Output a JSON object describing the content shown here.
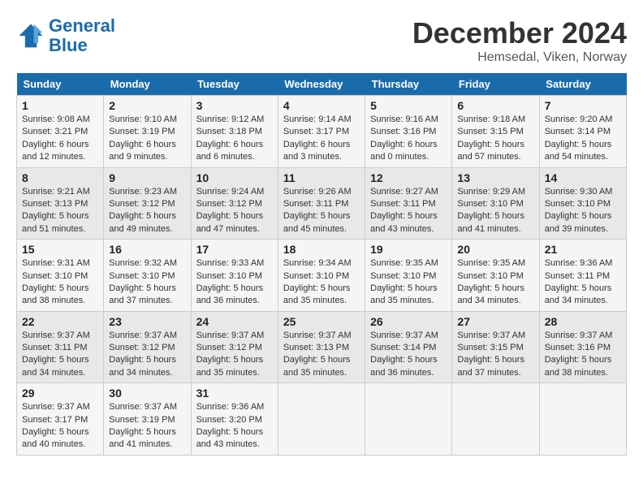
{
  "logo": {
    "line1": "General",
    "line2": "Blue"
  },
  "title": "December 2024",
  "location": "Hemsedal, Viken, Norway",
  "weekdays": [
    "Sunday",
    "Monday",
    "Tuesday",
    "Wednesday",
    "Thursday",
    "Friday",
    "Saturday"
  ],
  "weeks": [
    [
      {
        "day": "1",
        "sunrise": "9:08 AM",
        "sunset": "3:21 PM",
        "daylight": "6 hours and 12 minutes."
      },
      {
        "day": "2",
        "sunrise": "9:10 AM",
        "sunset": "3:19 PM",
        "daylight": "6 hours and 9 minutes."
      },
      {
        "day": "3",
        "sunrise": "9:12 AM",
        "sunset": "3:18 PM",
        "daylight": "6 hours and 6 minutes."
      },
      {
        "day": "4",
        "sunrise": "9:14 AM",
        "sunset": "3:17 PM",
        "daylight": "6 hours and 3 minutes."
      },
      {
        "day": "5",
        "sunrise": "9:16 AM",
        "sunset": "3:16 PM",
        "daylight": "6 hours and 0 minutes."
      },
      {
        "day": "6",
        "sunrise": "9:18 AM",
        "sunset": "3:15 PM",
        "daylight": "5 hours and 57 minutes."
      },
      {
        "day": "7",
        "sunrise": "9:20 AM",
        "sunset": "3:14 PM",
        "daylight": "5 hours and 54 minutes."
      }
    ],
    [
      {
        "day": "8",
        "sunrise": "9:21 AM",
        "sunset": "3:13 PM",
        "daylight": "5 hours and 51 minutes."
      },
      {
        "day": "9",
        "sunrise": "9:23 AM",
        "sunset": "3:12 PM",
        "daylight": "5 hours and 49 minutes."
      },
      {
        "day": "10",
        "sunrise": "9:24 AM",
        "sunset": "3:12 PM",
        "daylight": "5 hours and 47 minutes."
      },
      {
        "day": "11",
        "sunrise": "9:26 AM",
        "sunset": "3:11 PM",
        "daylight": "5 hours and 45 minutes."
      },
      {
        "day": "12",
        "sunrise": "9:27 AM",
        "sunset": "3:11 PM",
        "daylight": "5 hours and 43 minutes."
      },
      {
        "day": "13",
        "sunrise": "9:29 AM",
        "sunset": "3:10 PM",
        "daylight": "5 hours and 41 minutes."
      },
      {
        "day": "14",
        "sunrise": "9:30 AM",
        "sunset": "3:10 PM",
        "daylight": "5 hours and 39 minutes."
      }
    ],
    [
      {
        "day": "15",
        "sunrise": "9:31 AM",
        "sunset": "3:10 PM",
        "daylight": "5 hours and 38 minutes."
      },
      {
        "day": "16",
        "sunrise": "9:32 AM",
        "sunset": "3:10 PM",
        "daylight": "5 hours and 37 minutes."
      },
      {
        "day": "17",
        "sunrise": "9:33 AM",
        "sunset": "3:10 PM",
        "daylight": "5 hours and 36 minutes."
      },
      {
        "day": "18",
        "sunrise": "9:34 AM",
        "sunset": "3:10 PM",
        "daylight": "5 hours and 35 minutes."
      },
      {
        "day": "19",
        "sunrise": "9:35 AM",
        "sunset": "3:10 PM",
        "daylight": "5 hours and 35 minutes."
      },
      {
        "day": "20",
        "sunrise": "9:35 AM",
        "sunset": "3:10 PM",
        "daylight": "5 hours and 34 minutes."
      },
      {
        "day": "21",
        "sunrise": "9:36 AM",
        "sunset": "3:11 PM",
        "daylight": "5 hours and 34 minutes."
      }
    ],
    [
      {
        "day": "22",
        "sunrise": "9:37 AM",
        "sunset": "3:11 PM",
        "daylight": "5 hours and 34 minutes."
      },
      {
        "day": "23",
        "sunrise": "9:37 AM",
        "sunset": "3:12 PM",
        "daylight": "5 hours and 34 minutes."
      },
      {
        "day": "24",
        "sunrise": "9:37 AM",
        "sunset": "3:12 PM",
        "daylight": "5 hours and 35 minutes."
      },
      {
        "day": "25",
        "sunrise": "9:37 AM",
        "sunset": "3:13 PM",
        "daylight": "5 hours and 35 minutes."
      },
      {
        "day": "26",
        "sunrise": "9:37 AM",
        "sunset": "3:14 PM",
        "daylight": "5 hours and 36 minutes."
      },
      {
        "day": "27",
        "sunrise": "9:37 AM",
        "sunset": "3:15 PM",
        "daylight": "5 hours and 37 minutes."
      },
      {
        "day": "28",
        "sunrise": "9:37 AM",
        "sunset": "3:16 PM",
        "daylight": "5 hours and 38 minutes."
      }
    ],
    [
      {
        "day": "29",
        "sunrise": "9:37 AM",
        "sunset": "3:17 PM",
        "daylight": "5 hours and 40 minutes."
      },
      {
        "day": "30",
        "sunrise": "9:37 AM",
        "sunset": "3:19 PM",
        "daylight": "5 hours and 41 minutes."
      },
      {
        "day": "31",
        "sunrise": "9:36 AM",
        "sunset": "3:20 PM",
        "daylight": "5 hours and 43 minutes."
      },
      null,
      null,
      null,
      null
    ]
  ],
  "labels": {
    "sunrise": "Sunrise:",
    "sunset": "Sunset:",
    "daylight": "Daylight:"
  }
}
